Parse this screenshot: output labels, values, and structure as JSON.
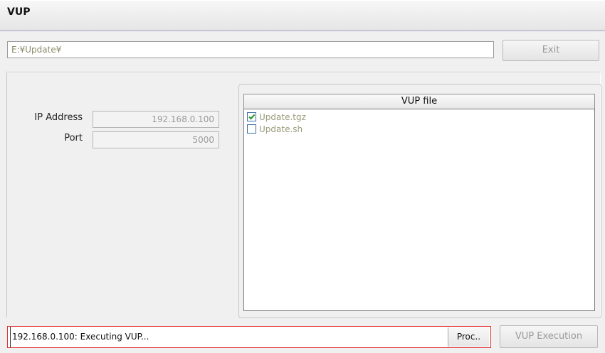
{
  "window": {
    "title": "VUP"
  },
  "toolbar": {
    "path_value": "E:¥Update¥",
    "exit_label": "Exit"
  },
  "connection": {
    "ip_label": "IP Address",
    "ip_value": "192.168.0.100",
    "port_label": "Port",
    "port_value": "5000"
  },
  "files": {
    "header": "VUP file",
    "items": [
      {
        "name": "Update.tgz",
        "checked": true
      },
      {
        "name": "Update.sh",
        "checked": false
      }
    ]
  },
  "status": {
    "text": "192.168.0.100: Executing VUP...",
    "proc_label": "Proc..",
    "execute_label": "VUP Execution"
  }
}
